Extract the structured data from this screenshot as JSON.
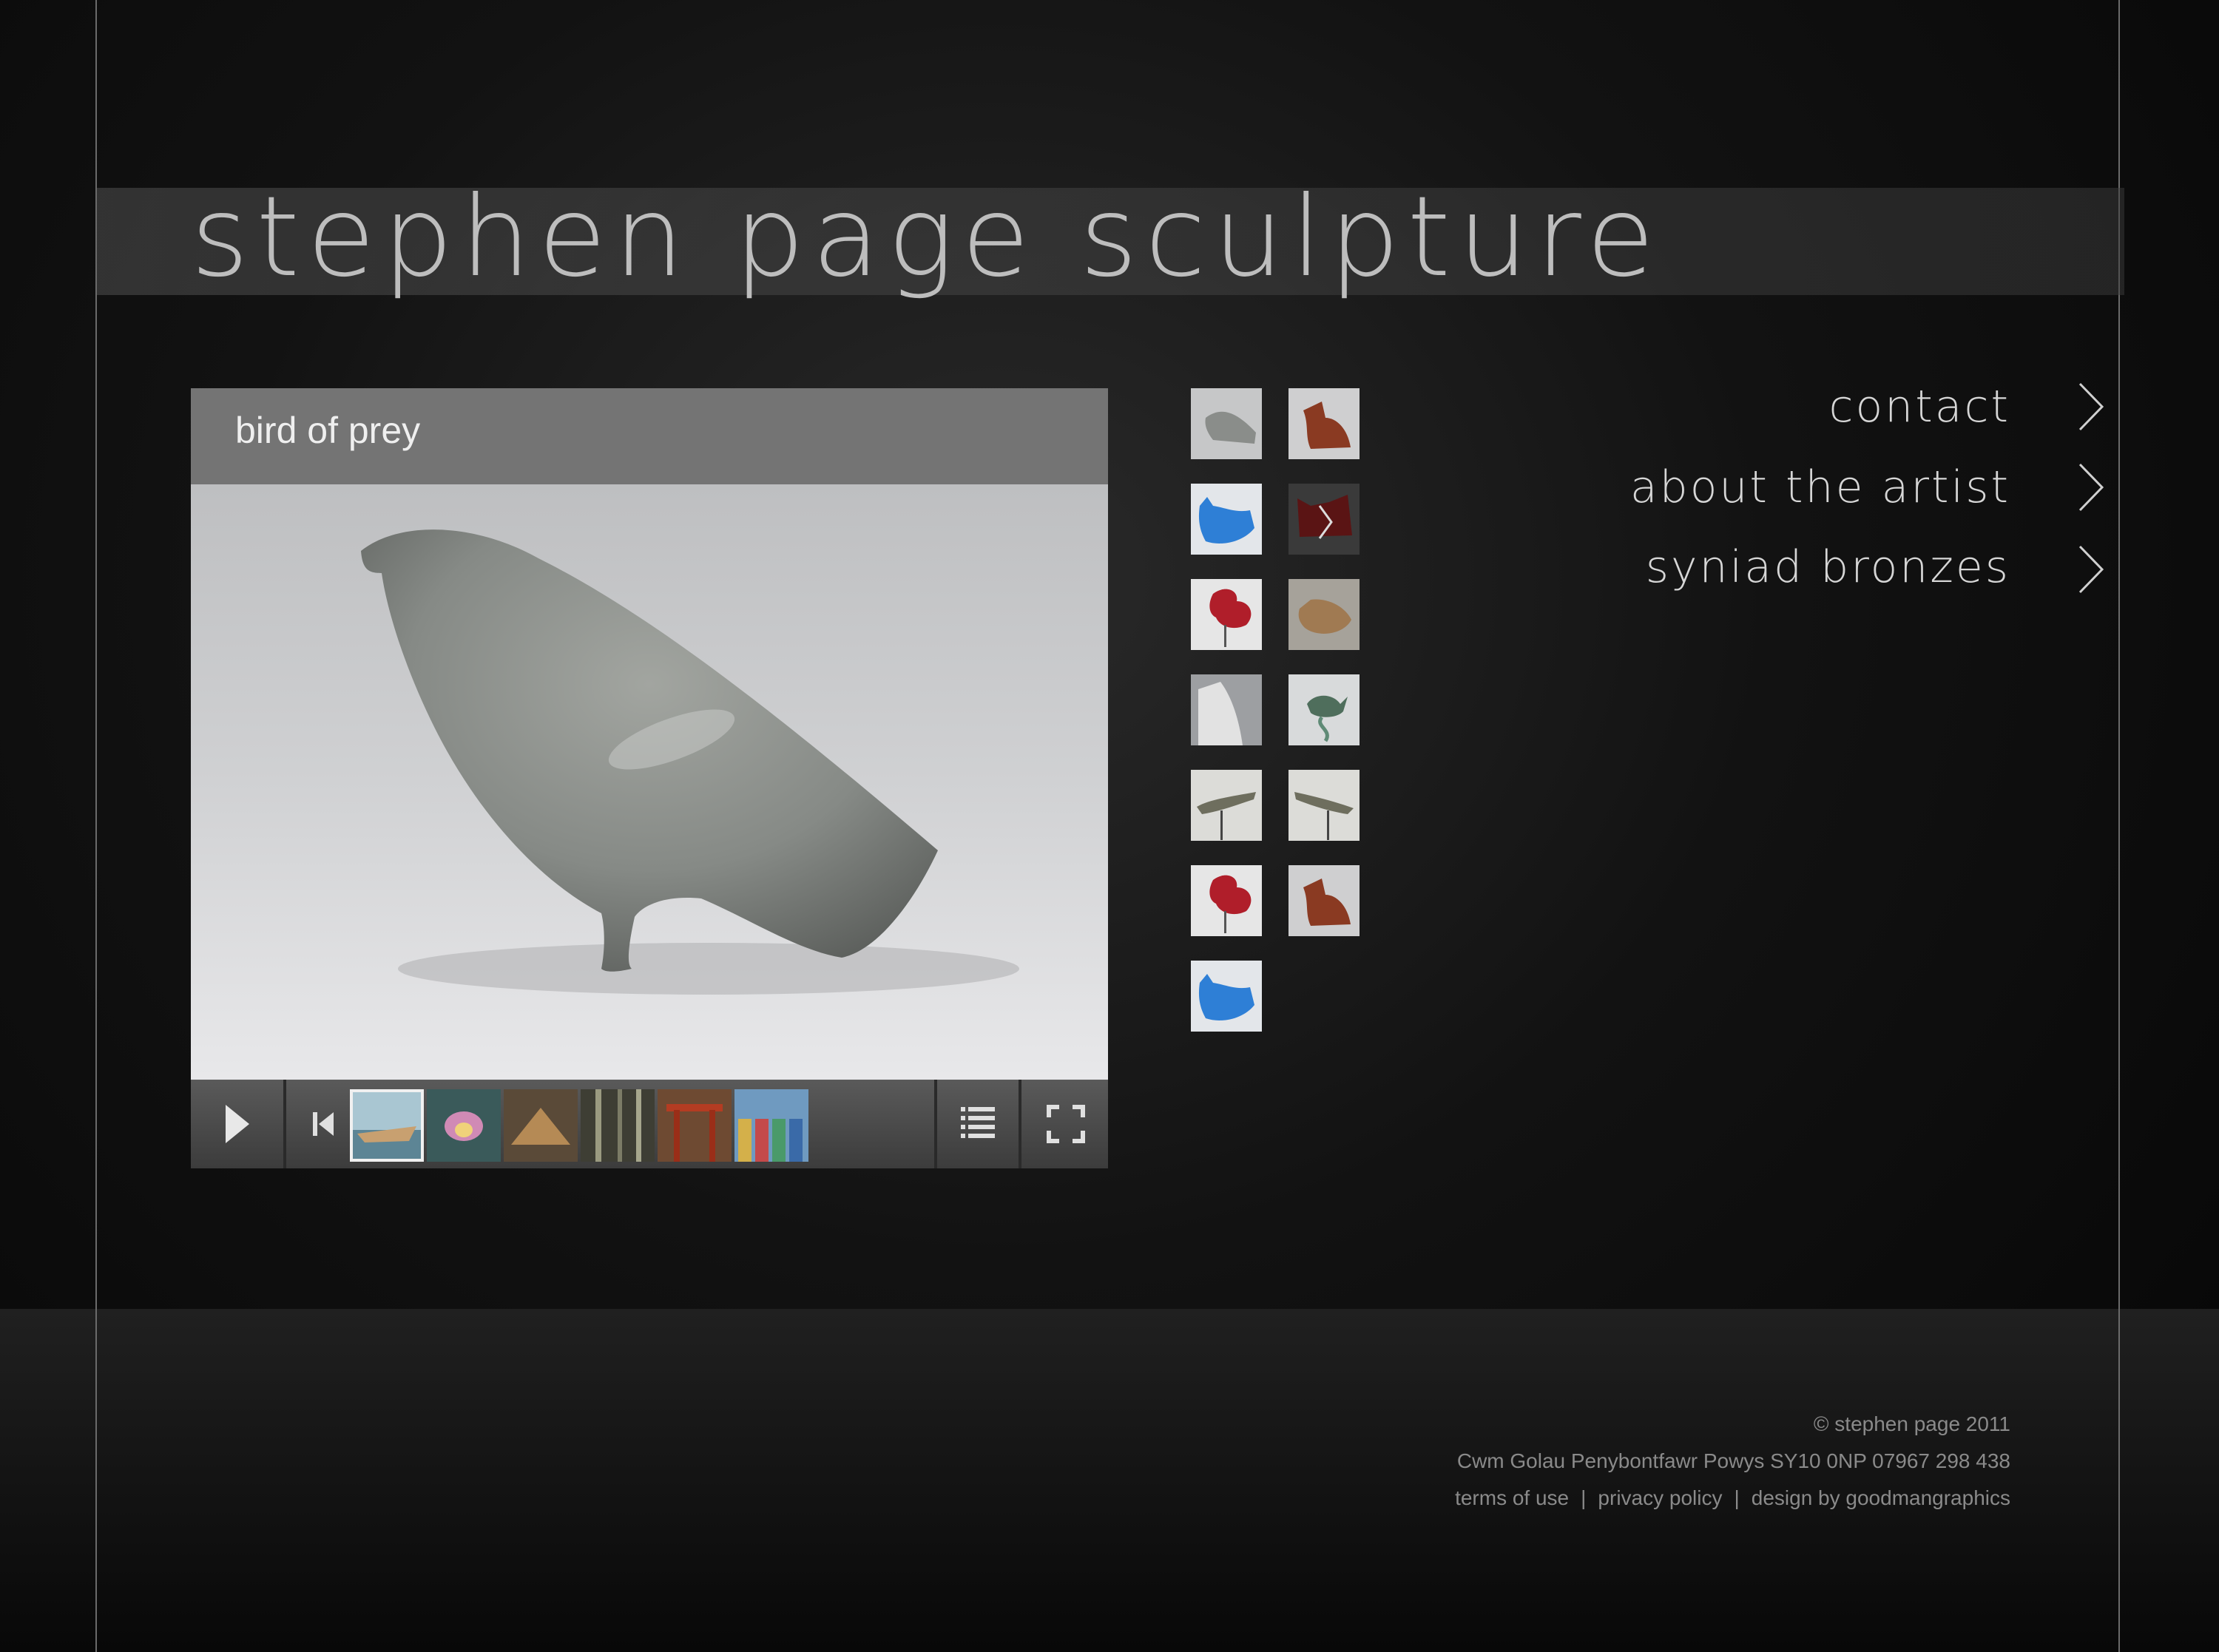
{
  "site": {
    "title": "stephen page sculpture"
  },
  "viewer": {
    "caption": "bird of prey",
    "controls": {
      "play_icon": "play-icon",
      "prev_icon": "skip-previous-icon",
      "next_icon": "skip-next-icon",
      "list_icon": "list-icon",
      "fullscreen_icon": "fullscreen-icon"
    },
    "strip": [
      {
        "name": "boat",
        "color": "#8fb2c2"
      },
      {
        "name": "lotus",
        "color": "#b77aa0"
      },
      {
        "name": "pyramid",
        "color": "#8a6a40"
      },
      {
        "name": "bamboo",
        "color": "#4b4b3e"
      },
      {
        "name": "torii",
        "color": "#9a4a2a"
      },
      {
        "name": "beach-huts",
        "color": "#4f7fa6"
      }
    ]
  },
  "gallery": {
    "thumbnails": [
      {
        "name": "grey-bird",
        "color": "#8e8e8e"
      },
      {
        "name": "red-hen",
        "color": "#8a3a22"
      },
      {
        "name": "blue-cat",
        "color": "#2e7fd6"
      },
      {
        "name": "dark-red-cat",
        "color": "#5a1414"
      },
      {
        "name": "red-rooster",
        "color": "#b01e2a"
      },
      {
        "name": "brown-bird",
        "color": "#a07a52"
      },
      {
        "name": "white-form",
        "color": "#d8d8d8"
      },
      {
        "name": "green-wren",
        "color": "#5f7d6a"
      },
      {
        "name": "hare-left",
        "color": "#6e6e5e"
      },
      {
        "name": "hare-right",
        "color": "#6e6e5e"
      },
      {
        "name": "red-rooster-2",
        "color": "#b01e2a"
      },
      {
        "name": "red-hen-2",
        "color": "#8a3a22"
      },
      {
        "name": "blue-cat-2",
        "color": "#2e7fd6"
      }
    ]
  },
  "nav": {
    "items": [
      {
        "label": "contact"
      },
      {
        "label": "about the artist"
      },
      {
        "label": "syniad bronzes"
      }
    ]
  },
  "footer": {
    "copyright": "© stephen page 2011",
    "address": "Cwm Golau Penybontfawr Powys SY10 0NP 07967 298 438",
    "links": {
      "terms": "terms of use",
      "privacy": "privacy policy",
      "design": "design by goodmangraphics",
      "separator": "|"
    }
  }
}
